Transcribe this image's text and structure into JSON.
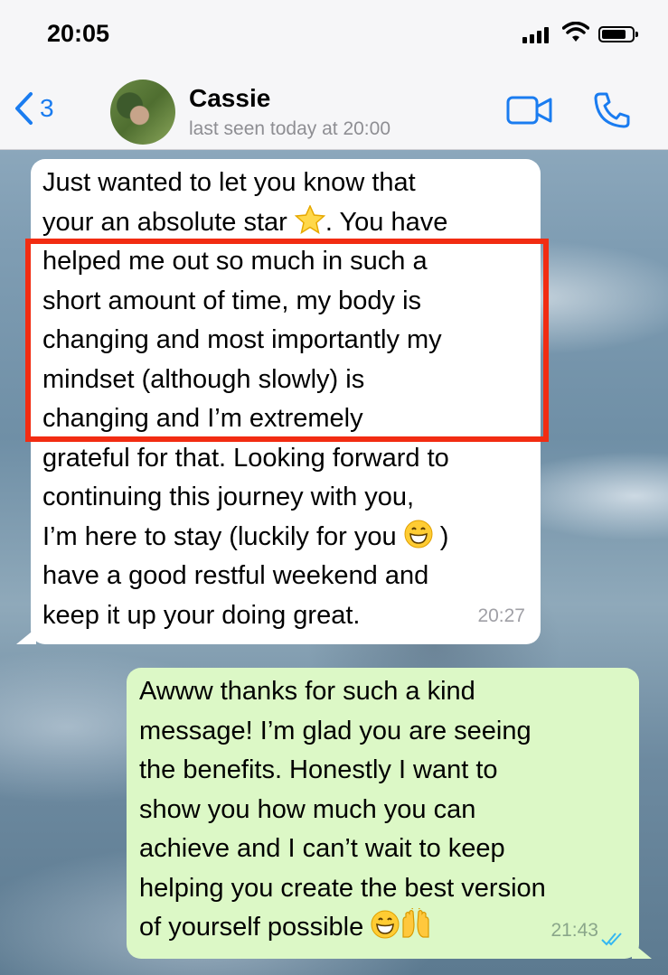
{
  "status_bar": {
    "time": "20:05"
  },
  "nav": {
    "back_count": "3",
    "contact_name": "Cassie",
    "contact_status": "last seen today at 20:00"
  },
  "messages": [
    {
      "direction": "incoming",
      "lines": [
        "Just wanted to let you know that",
        "your an absolute star",
        ". You have",
        "helped me out so much in such a",
        "short amount of time, my body is",
        "changing and most importantly my",
        "mindset (although slowly) is",
        "changing and I’m extremely",
        "grateful for that. Looking forward to",
        "continuing this journey with you,",
        "I’m here to stay (luckily for you",
        ")",
        "have a good restful weekend and",
        "keep it up your doing great."
      ],
      "time": "20:27"
    },
    {
      "direction": "outgoing",
      "lines": [
        "Awww thanks for such a kind",
        "message! I’m glad you are seeing",
        "the benefits. Honestly I want to",
        "show you how much you can",
        "achieve and I can’t wait to keep",
        "helping you create the best version",
        "of yourself possible"
      ],
      "time": "21:43",
      "read": true
    }
  ],
  "colors": {
    "accent": "#1a7cf0",
    "outgoing_bubble": "#dcf8c6",
    "incoming_bubble": "#ffffff",
    "highlight_box": "#f22c12",
    "read_ticks": "#34b7f1"
  },
  "icons": [
    "back-chevron-icon",
    "video-call-icon",
    "phone-icon",
    "star-emoji-icon",
    "grin-emoji-icon",
    "raised-hands-emoji-icon",
    "double-check-icon"
  ]
}
